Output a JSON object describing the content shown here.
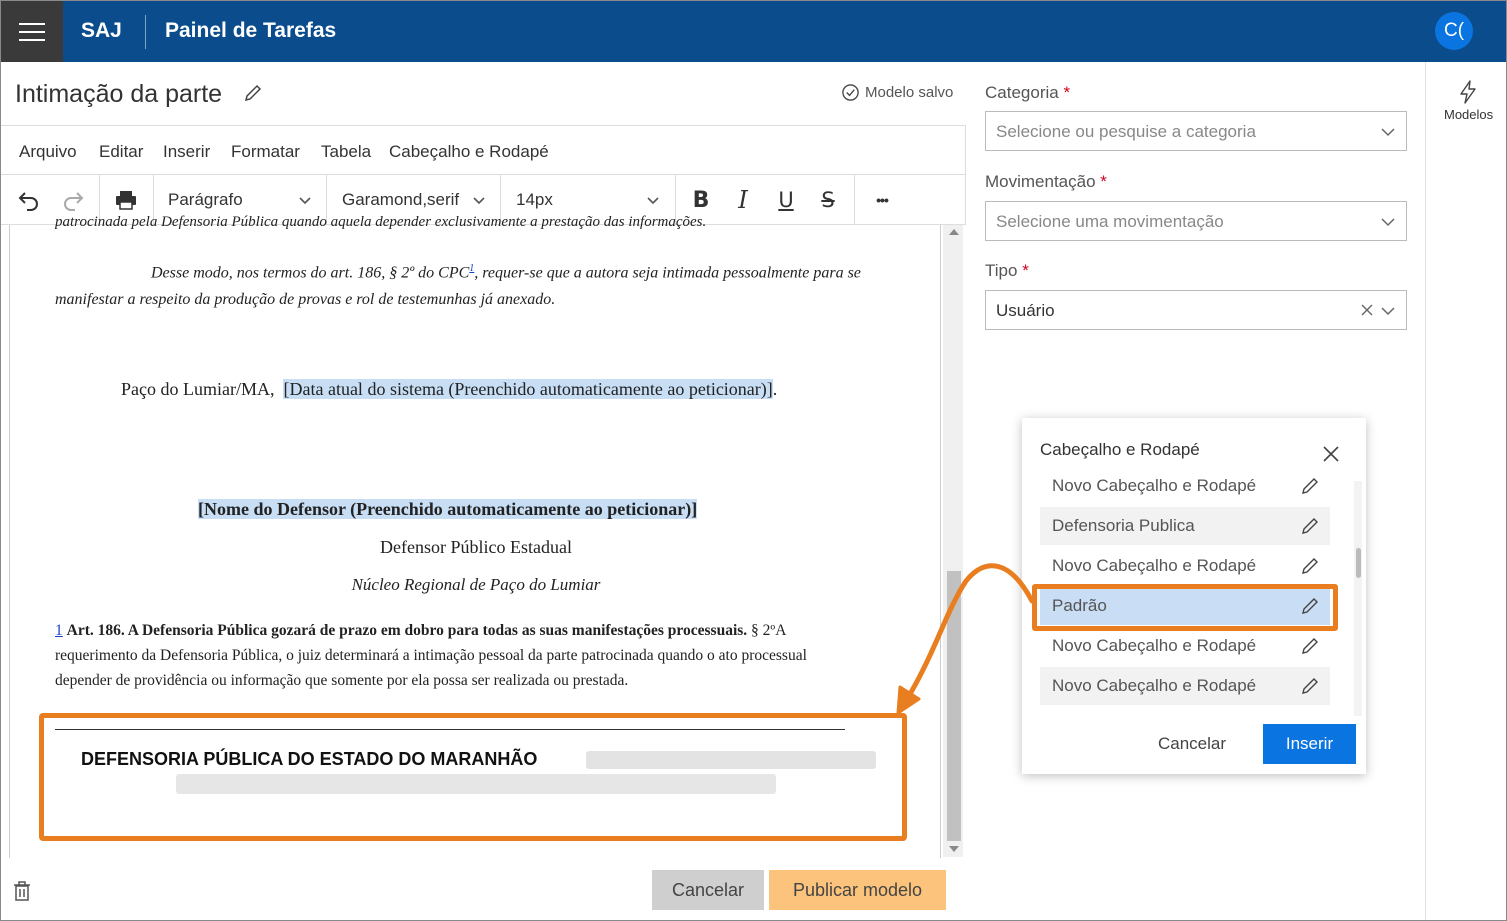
{
  "header": {
    "brand": "SAJ",
    "app_title": "Painel de Tarefas",
    "avatar_initials": "C("
  },
  "editor": {
    "doc_title": "Intimação da parte",
    "saved_status": "Modelo salvo",
    "menu": [
      "Arquivo",
      "Editar",
      "Inserir",
      "Formatar",
      "Tabela",
      "Cabeçalho e Rodapé"
    ],
    "toolbar": {
      "paragraph": "Parágrafo",
      "font": "Garamond,serif",
      "size": "14px",
      "bold": "B",
      "italic": "I",
      "underline": "U",
      "strike": "S",
      "more": "•••"
    }
  },
  "document": {
    "p1_cut": "patrocinada pela Defensoria Pública quando aquela depender exclusivamente a prestação das informações.",
    "p2": "Desse modo, nos termos do art. 186, § 2º do CPC",
    "p2_sup": "1",
    "p2_rest": ", requer-se que a autora seja intimada pessoalmente para se",
    "p3": "manifestar a respeito da produção de provas e rol de testemunhas já anexado.",
    "place": "Paço do Lumiar/MA,",
    "date_placeholder": "[Data atual do sistema (Preenchido automaticamente ao peticionar)]",
    "date_end": ".",
    "defender_placeholder": "[Nome do Defensor (Preenchido automaticamente ao peticionar)]",
    "defender_role": "Defensor Público Estadual",
    "nucleo": "Núcleo Regional de Paço do Lumiar",
    "fn_num": "1",
    "fn_bold": "Art. 186.  A Defensoria Pública gozará de prazo em dobro para todas as suas manifestações processuais.",
    "fn_rest_1": " § 2ºA",
    "fn_rest_2": "requerimento da Defensoria Pública, o juiz determinará a intimação pessoal da parte patrocinada quando o ato processual",
    "fn_rest_3": "depender de providência ou informação que somente por ela possa ser realizada ou prestada.",
    "footer_title": "DEFENSORIA PÚBLICA DO ESTADO DO MARANHÃO"
  },
  "actions": {
    "cancel": "Cancelar",
    "publish": "Publicar modelo"
  },
  "form": {
    "categoria_label": "Categoria",
    "categoria_placeholder": "Selecione ou pesquise a categoria",
    "movimentacao_label": "Movimentação",
    "movimentacao_placeholder": "Selecione uma movimentação",
    "tipo_label": "Tipo",
    "tipo_value": "Usuário",
    "required_mark": "*"
  },
  "rail": {
    "modelos_label": "Modelos"
  },
  "popup": {
    "title": "Cabeçalho e Rodapé",
    "items": [
      "Novo Cabeçalho e Rodapé",
      "Defensoria Publica",
      "Novo Cabeçalho e Rodapé",
      "Padrão",
      "Novo Cabeçalho e Rodapé",
      "Novo Cabeçalho e Rodapé"
    ],
    "selected_index": 3,
    "cancel": "Cancelar",
    "insert": "Inserir"
  },
  "colors": {
    "topbar": "#0b4d8c",
    "accent": "#0a74e0",
    "highlight_callout": "#e87e1f",
    "publish_button": "#fbc37b",
    "selection": "#c9def5"
  }
}
